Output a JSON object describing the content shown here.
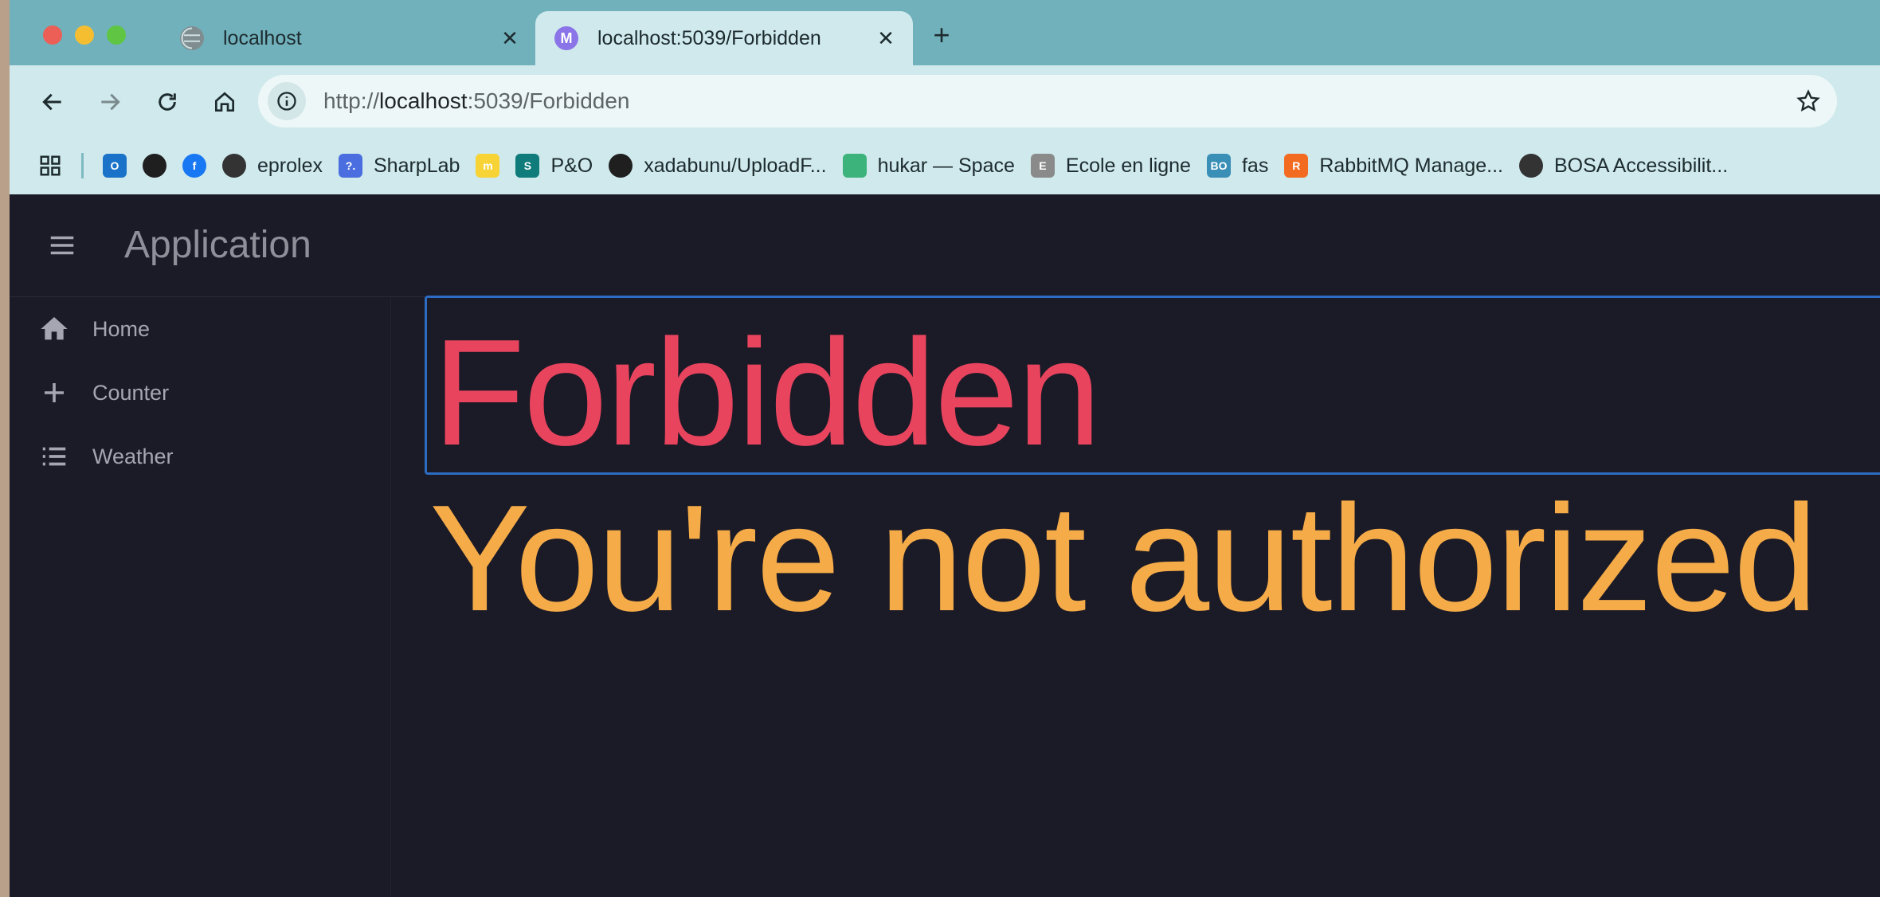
{
  "browser": {
    "tabs": [
      {
        "label": "localhost",
        "active": false,
        "favicon": "globe-icon"
      },
      {
        "label": "localhost:5039/Forbidden",
        "active": true,
        "favicon_text": "M"
      }
    ],
    "url": {
      "scheme": "http://",
      "host": "localhost",
      "rest": ":5039/Forbidden"
    },
    "bookmarks": [
      {
        "label": "",
        "icon": "outlook-icon",
        "color": "#1a73c9",
        "text": "O"
      },
      {
        "label": "",
        "icon": "github-icon",
        "color": "#1f1f1f",
        "text": ""
      },
      {
        "label": "",
        "icon": "facebook-icon",
        "color": "#1877f2",
        "text": "f"
      },
      {
        "label": "eprolex",
        "icon": "globe-icon",
        "color": "#333333",
        "text": ""
      },
      {
        "label": "SharpLab",
        "icon": "sharplab-icon",
        "color": "#4a6ee0",
        "text": "?."
      },
      {
        "label": "",
        "icon": "miro-icon",
        "color": "#f7d336",
        "text": "m"
      },
      {
        "label": "P&O",
        "icon": "sharepoint-icon",
        "color": "#0f7b7b",
        "text": "S"
      },
      {
        "label": "xadabunu/UploadF...",
        "icon": "github-icon",
        "color": "#1f1f1f",
        "text": ""
      },
      {
        "label": "hukar — Space",
        "icon": "space-icon",
        "color": "#3bb37a",
        "text": ""
      },
      {
        "label": "Ecole en ligne",
        "icon": "school-icon",
        "color": "#8a8a8a",
        "text": "E"
      },
      {
        "label": "fas",
        "icon": "bosa-icon",
        "color": "#3a8fb7",
        "text": "BO"
      },
      {
        "label": "RabbitMQ Manage...",
        "icon": "rabbitmq-icon",
        "color": "#f26b21",
        "text": "R"
      },
      {
        "label": "BOSA Accessibilit...",
        "icon": "globe-icon",
        "color": "#333333",
        "text": ""
      }
    ]
  },
  "app": {
    "title": "Application",
    "nav": [
      {
        "label": "Home",
        "icon": "home-icon"
      },
      {
        "label": "Counter",
        "icon": "plus-icon"
      },
      {
        "label": "Weather",
        "icon": "list-icon"
      }
    ],
    "heading": "Forbidden",
    "message": "You're not authorized"
  },
  "colors": {
    "heading": "#e8445e",
    "message": "#f4ab48",
    "background": "#1b1a27",
    "chrome": "#cfe9ec"
  }
}
